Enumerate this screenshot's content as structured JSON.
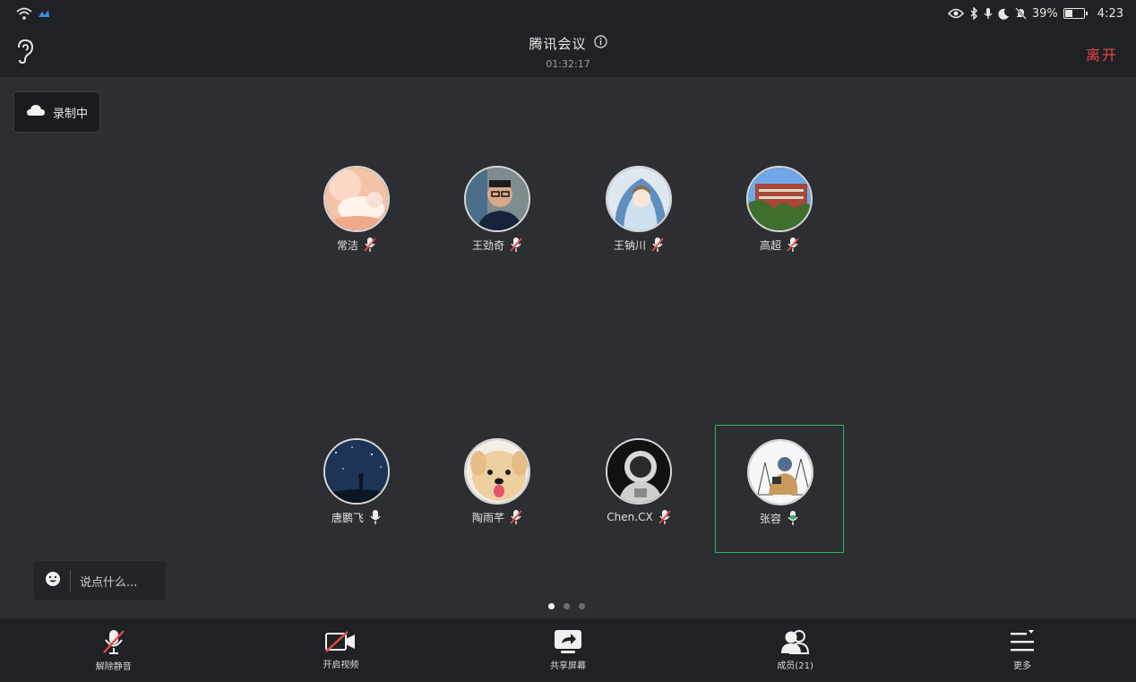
{
  "status_bar": {
    "battery_percent": "39%",
    "battery_level": 0.39,
    "time": "4:23",
    "icons_left": [
      "wifi-icon",
      "signal-icon"
    ],
    "icons_right": [
      "eye-icon",
      "bluetooth-icon",
      "mic-icon",
      "moon-icon",
      "bell-off-icon",
      "battery-icon"
    ]
  },
  "header": {
    "title": "腾讯会议",
    "timer": "01:32:17",
    "leave_label": "离开"
  },
  "recording": {
    "label": "录制中"
  },
  "participants": [
    {
      "name": "常洁",
      "mic": "muted"
    },
    {
      "name": "王劲奇",
      "mic": "muted"
    },
    {
      "name": "王钠川",
      "mic": "muted"
    },
    {
      "name": "高超",
      "mic": "muted"
    },
    {
      "name": "唐鹏飞",
      "mic": "on"
    },
    {
      "name": "陶雨芊",
      "mic": "muted"
    },
    {
      "name": "Chen.CX",
      "mic": "muted"
    },
    {
      "name": "张容",
      "mic": "speaking",
      "active": true
    }
  ],
  "chat": {
    "placeholder": "说点什么..."
  },
  "pager": {
    "pages": 3,
    "current": 1
  },
  "toolbar": {
    "unmute_label": "解除静音",
    "video_label": "开启视频",
    "share_label": "共享屏幕",
    "members_label": "成员(21)",
    "more_label": "更多"
  },
  "colors": {
    "leave": "#e84545",
    "active_border": "#2db55d",
    "muted_slash": "#e84545"
  }
}
